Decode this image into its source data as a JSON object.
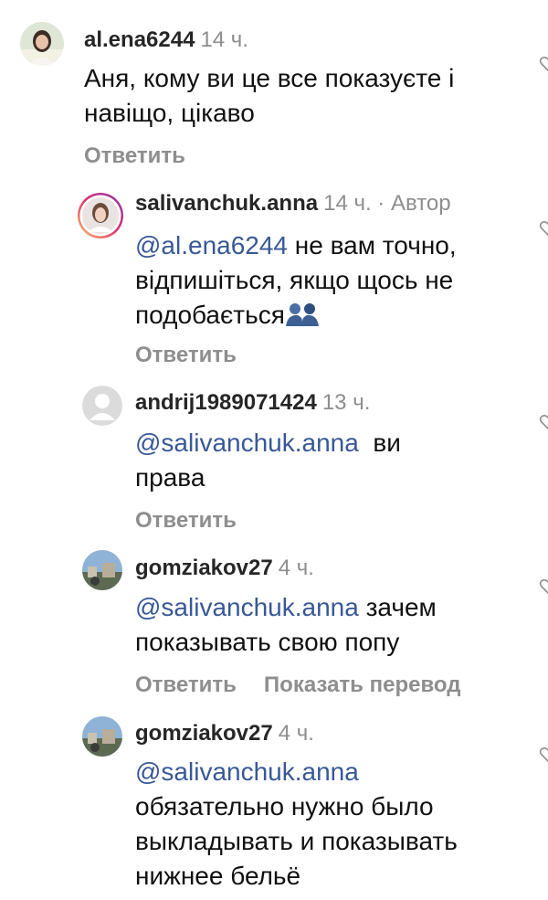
{
  "comments": [
    {
      "username": "al.ena6244",
      "time": "14 ч.",
      "lines": [
        "Аня, кому ви це все показуєте і",
        "навіщо, цікаво"
      ],
      "reply_label": "Ответить"
    },
    {
      "username": "salivanchuk.anna",
      "time": "14 ч. · Автор",
      "mention": "@al.ena6244",
      "lines": [
        " не вам точно,",
        "відпишіться, якщо щось не",
        "подобається"
      ],
      "emoji": "🫂",
      "reply_label": "Ответить"
    },
    {
      "username": "andrij1989071424",
      "time": "13 ч.",
      "mention": "@salivanchuk.anna",
      "lines": [
        "  ви",
        "права"
      ],
      "reply_label": "Ответить"
    },
    {
      "username": "gomziakov27",
      "time": "4 ч.",
      "mention": "@salivanchuk.anna",
      "lines": [
        " зачем",
        "показывать свою попу"
      ],
      "reply_label": "Ответить",
      "translate_label": "Показать перевод"
    },
    {
      "username": "gomziakov27",
      "time": "4 ч.",
      "mention": "@salivanchuk.anna",
      "lines": [
        "обязательно нужно было",
        "выкладывать и показывать",
        "нижнее бельё"
      ]
    }
  ],
  "colors": {
    "mention": "#385898",
    "secondary": "#8e8e8e",
    "primary": "#262626"
  }
}
